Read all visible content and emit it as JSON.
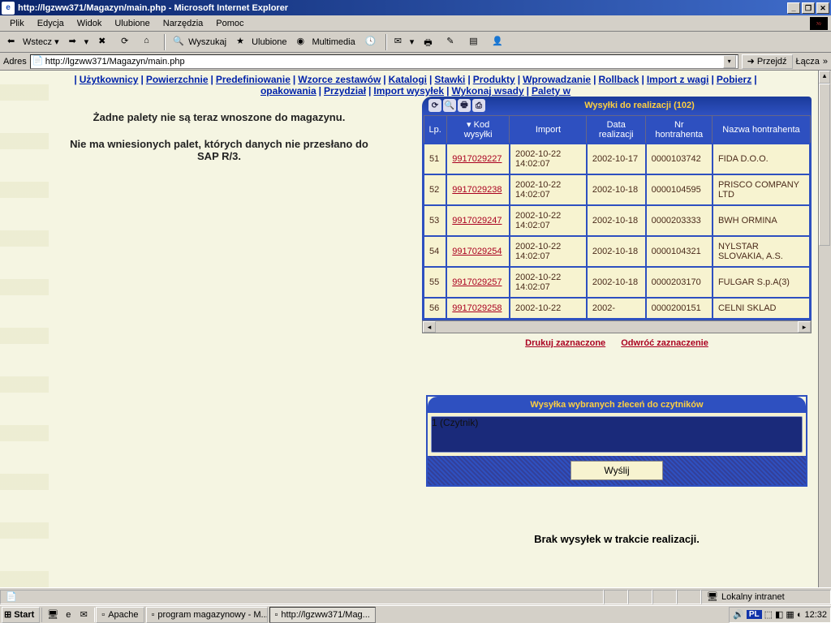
{
  "window": {
    "title": "http://lgzww371/Magazyn/main.php - Microsoft Internet Explorer"
  },
  "menubar": [
    "Plik",
    "Edycja",
    "Widok",
    "Ulubione",
    "Narzędzia",
    "Pomoc"
  ],
  "toolbar": {
    "back": "Wstecz",
    "search": "Wyszukaj",
    "favorites": "Ulubione",
    "media": "Multimedia"
  },
  "addressbar": {
    "label": "Adres",
    "url": "http://lgzww371/Magazyn/main.php",
    "go": "Przejdź",
    "links": "Łącza"
  },
  "appnav": {
    "row1": [
      "Użytkownicy",
      "Powierzchnie",
      "Predefiniowanie",
      "Wzorce zestawów",
      "Katalogi",
      "Stawki",
      "Produkty",
      "Wprowadzanie",
      "Rollback",
      "Import z wagi",
      "Pobierz"
    ],
    "row2": [
      "opakowania",
      "Przydział",
      "Import wysyłek",
      "Wykonaj wsady",
      "Palety w"
    ]
  },
  "messages": {
    "line1": "Żadne palety nie są teraz wnoszone do magazynu.",
    "line2": "Nie ma wniesionych palet, których danych nie przesłano do SAP R/3."
  },
  "panel": {
    "title": "Wysyłki do realizacji (102)",
    "columns": [
      "Lp.",
      "Kod wysyłki",
      "Import",
      "Data realizacji",
      "Nr hontrahenta",
      "Nazwa hontrahenta"
    ],
    "rows": [
      {
        "lp": "51",
        "kod": "9917029227",
        "import": "2002-10-22 14:02:07",
        "data": "2002-10-17",
        "nr": "0000103742",
        "nazwa": "FIDA D.O.O."
      },
      {
        "lp": "52",
        "kod": "9917029238",
        "import": "2002-10-22 14:02:07",
        "data": "2002-10-18",
        "nr": "0000104595",
        "nazwa": "PRISCO COMPANY LTD"
      },
      {
        "lp": "53",
        "kod": "9917029247",
        "import": "2002-10-22 14:02:07",
        "data": "2002-10-18",
        "nr": "0000203333",
        "nazwa": "BWH ORMINA"
      },
      {
        "lp": "54",
        "kod": "9917029254",
        "import": "2002-10-22 14:02:07",
        "data": "2002-10-18",
        "nr": "0000104321",
        "nazwa": "NYLSTAR SLOVAKIA, A.S."
      },
      {
        "lp": "55",
        "kod": "9917029257",
        "import": "2002-10-22 14:02:07",
        "data": "2002-10-18",
        "nr": "0000203170",
        "nazwa": "FULGAR S.p.A(3)"
      },
      {
        "lp": "56",
        "kod": "9917029258",
        "import": "2002-10-22",
        "data": "2002-",
        "nr": "0000200151",
        "nazwa": "CELNI SKLAD"
      }
    ],
    "print_link": "Drukuj zaznaczone",
    "invert_link": "Odwróć zaznaczenie"
  },
  "sendpanel": {
    "title": "Wysyłka wybranych zleceń do czytników",
    "option": "1 (Czytnik)",
    "button": "Wyślij"
  },
  "brak": "Brak wysyłek w trakcie realizacji.",
  "statusbar": {
    "zone": "Lokalny intranet"
  },
  "taskbar": {
    "start": "Start",
    "tasks": [
      {
        "label": "Apache",
        "active": false
      },
      {
        "label": "program magazynowy - M...",
        "active": false
      },
      {
        "label": "http://lgzww371/Mag...",
        "active": true
      }
    ],
    "lang": "PL",
    "clock": "12:32"
  }
}
